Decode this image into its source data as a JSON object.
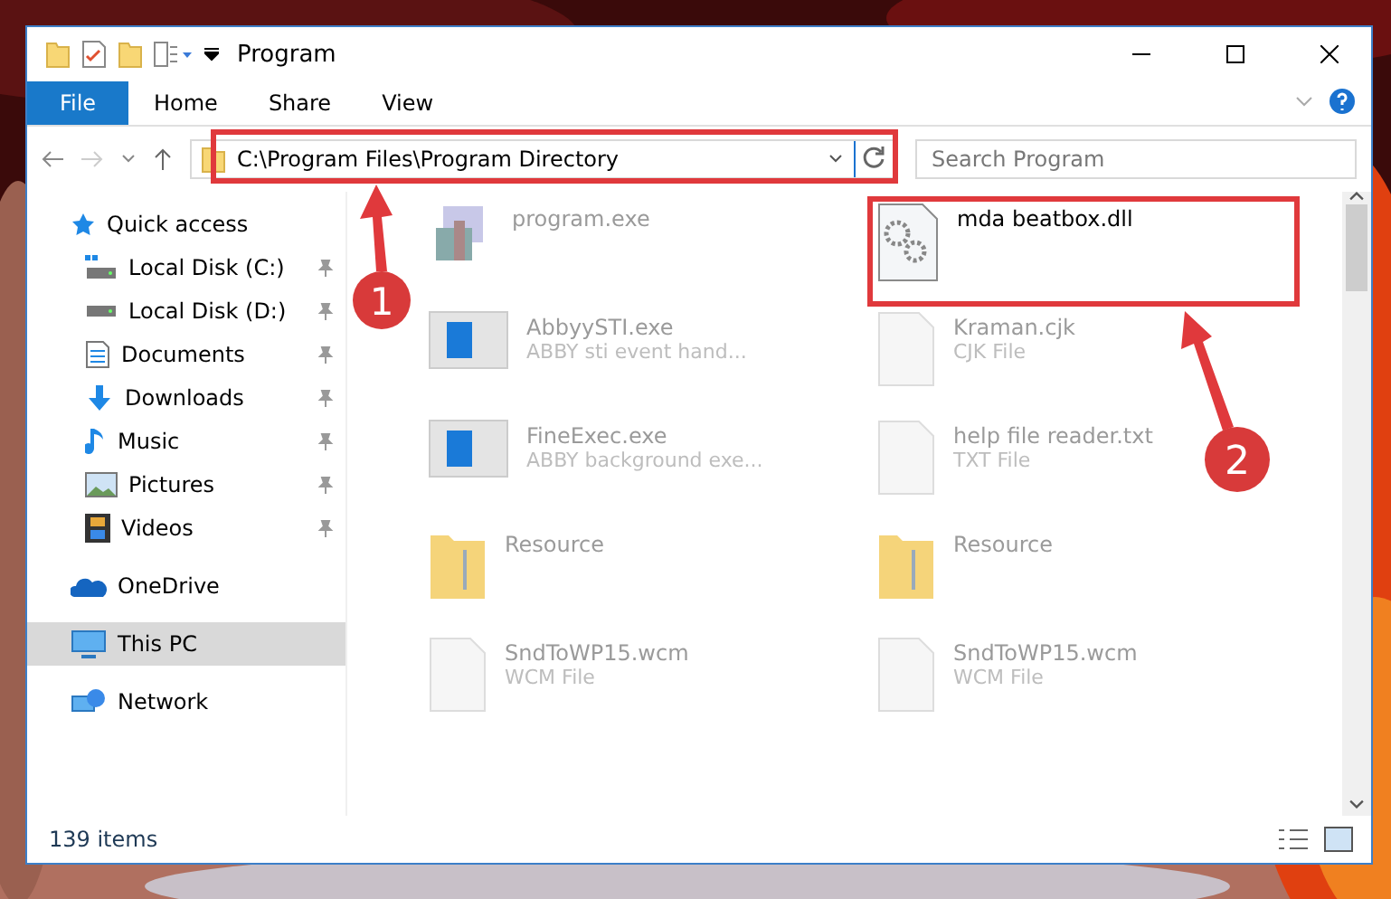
{
  "window": {
    "title": "Program"
  },
  "ribbon": {
    "file_tab": "File",
    "tabs": [
      "Home",
      "Share",
      "View"
    ]
  },
  "address_bar": {
    "path": "C:\\Program Files\\Program Directory"
  },
  "search": {
    "placeholder": "Search Program"
  },
  "sidebar": {
    "items": [
      {
        "label": "Quick access",
        "selected": false,
        "children": [
          {
            "label": "Local Disk (C:)",
            "selected": false,
            "pinned": true
          },
          {
            "label": "Local Disk (D:)",
            "selected": false,
            "pinned": true
          },
          {
            "label": "Documents",
            "selected": false,
            "pinned": true
          },
          {
            "label": "Downloads",
            "selected": false,
            "pinned": true
          },
          {
            "label": "Music",
            "selected": false,
            "pinned": true
          },
          {
            "label": "Pictures",
            "selected": false,
            "pinned": true
          },
          {
            "label": "Videos",
            "selected": false,
            "pinned": true
          }
        ]
      },
      {
        "label": "OneDrive",
        "selected": false
      },
      {
        "label": "This PC",
        "selected": true
      },
      {
        "label": "Network",
        "selected": false
      }
    ]
  },
  "files": [
    {
      "name": "program.exe",
      "kind": "installer",
      "selected": false
    },
    {
      "name": "mda beatbox.dll",
      "kind": "dll",
      "selected": true
    },
    {
      "name": "AbbyySTI.exe",
      "description": "ABBY sti event hand...",
      "kind": "app",
      "selected": false
    },
    {
      "name": "Kraman.cjk",
      "description": "CJK File",
      "kind": "file",
      "selected": false
    },
    {
      "name": "FineExec.exe",
      "description": "ABBY background exe...",
      "kind": "app",
      "selected": false
    },
    {
      "name": "help file reader.txt",
      "description": "TXT File",
      "kind": "file",
      "selected": false
    },
    {
      "name": "Resource",
      "kind": "folder",
      "selected": false
    },
    {
      "name": "Resource",
      "kind": "folder",
      "selected": false
    },
    {
      "name": "SndToWP15.wcm",
      "description": "WCM File",
      "kind": "file",
      "selected": false
    },
    {
      "name": "SndToWP15.wcm",
      "description": "WCM File",
      "kind": "file",
      "selected": false
    }
  ],
  "status_bar": {
    "item_count": "139 items"
  },
  "annotations": [
    {
      "number": "1"
    },
    {
      "number": "2"
    }
  ]
}
